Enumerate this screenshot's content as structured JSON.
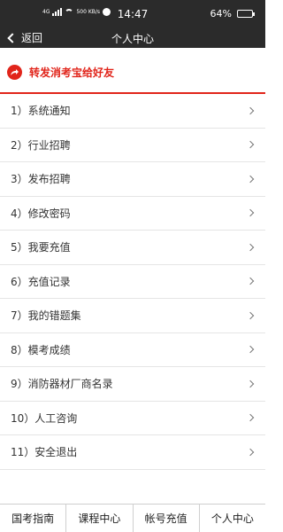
{
  "status_bar": {
    "network_label": "4G",
    "speed_label": "500 KB/s",
    "time": "14:47",
    "battery_percent_text": "64%",
    "battery_level": 0.64
  },
  "nav": {
    "back_label": "返回",
    "title": "个人中心"
  },
  "share": {
    "label": "转发消考宝给好友",
    "accent_color": "#e1251b"
  },
  "menu": {
    "items": [
      {
        "label": "1）系统通知"
      },
      {
        "label": "2）行业招聘"
      },
      {
        "label": "3）发布招聘"
      },
      {
        "label": "4）修改密码"
      },
      {
        "label": "5）我要充值"
      },
      {
        "label": "6）充值记录"
      },
      {
        "label": "7）我的错题集"
      },
      {
        "label": "8）模考成绩"
      },
      {
        "label": "9）消防器材厂商名录"
      },
      {
        "label": "10）人工咨询"
      },
      {
        "label": "11）安全退出"
      }
    ]
  },
  "tabs": [
    {
      "label": "国考指南"
    },
    {
      "label": "课程中心"
    },
    {
      "label": "帐号充值"
    },
    {
      "label": "个人中心"
    }
  ]
}
